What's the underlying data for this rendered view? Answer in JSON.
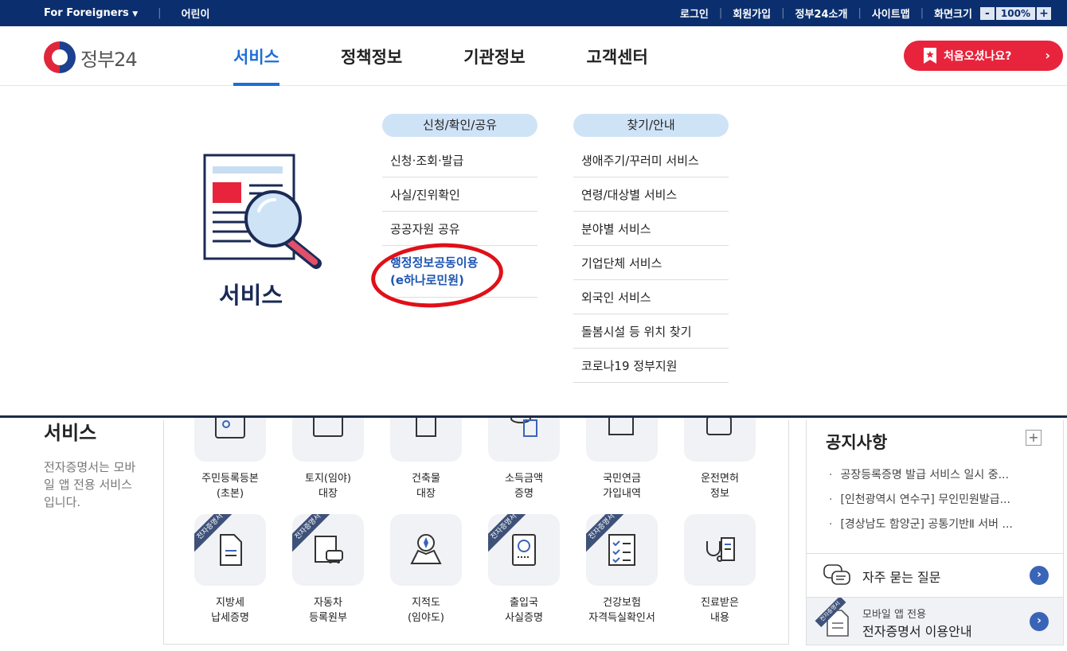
{
  "topbar": {
    "foreigners": "For Foreigners",
    "kids": "어린이",
    "links": [
      "로그인",
      "회원가입",
      "정부24소개",
      "사이트맵"
    ],
    "screen_size_label": "화면크기",
    "zoom_minus": "-",
    "zoom_value": "100%",
    "zoom_plus": "+"
  },
  "header": {
    "logo_text": "정부24",
    "nav": [
      "서비스",
      "정책정보",
      "기관정보",
      "고객센터"
    ],
    "first_visit": "처음오셨나요?"
  },
  "mega": {
    "title": "서비스",
    "col1": {
      "heading": "신청/확인/공유",
      "items": [
        "신청·조회·발급",
        "사실/진위확인",
        "공공자원 공유"
      ],
      "highlight_line1": "행정정보공동이용",
      "highlight_line2": "(e하나로민원)"
    },
    "col2": {
      "heading": "찾기/안내",
      "items": [
        "생애주기/꾸러미 서비스",
        "연령/대상별 서비스",
        "분야별 서비스",
        "기업단체 서비스",
        "외국인 서비스",
        "돌봄시설 등 위치 찾기",
        "코로나19 정부지원"
      ]
    }
  },
  "content": {
    "title": "서비스",
    "desc": "전자증명서는 모바일 앱 전용 서비스입니다.",
    "row1": [
      {
        "line1": "주민등록등본",
        "line2": "(초본)"
      },
      {
        "line1": "토지(임야)",
        "line2": "대장"
      },
      {
        "line1": "건축물",
        "line2": "대장"
      },
      {
        "line1": "소득금액",
        "line2": "증명"
      },
      {
        "line1": "국민연금",
        "line2": "가입내역"
      },
      {
        "line1": "운전면허",
        "line2": "정보"
      }
    ],
    "row2": [
      {
        "line1": "지방세",
        "line2": "납세증명",
        "badge": "전자증명서"
      },
      {
        "line1": "자동차",
        "line2": "등록원부",
        "badge": "전자증명서"
      },
      {
        "line1": "지적도",
        "line2": "(임야도)",
        "badge": ""
      },
      {
        "line1": "출입국",
        "line2": "사실증명",
        "badge": "전자증명서"
      },
      {
        "line1": "건강보험",
        "line2": "자격득실확인서",
        "badge": "전자증명서"
      },
      {
        "line1": "진료받은",
        "line2": "내용",
        "badge": ""
      }
    ]
  },
  "notice": {
    "title": "공지사항",
    "more": "+",
    "items": [
      "공장등록증명 발급 서비스 일시 중...",
      "[인천광역시 연수구] 무인민원발급...",
      "[경상남도 함양군] 공통기반Ⅱ 서버 ..."
    ]
  },
  "faq": {
    "label": "자주 묻는 질문"
  },
  "mobile": {
    "small": "모바일 앱 전용",
    "big": "전자증명서 이용안내",
    "badge": "전자증명서"
  },
  "colors": {
    "topbar": "#0b2f6e",
    "accent": "#1d6ed8",
    "red": "#e8243c"
  }
}
